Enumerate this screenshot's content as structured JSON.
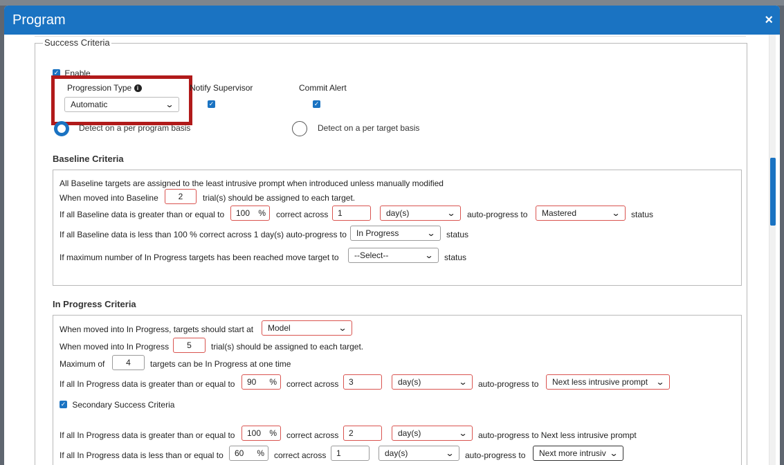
{
  "modal": {
    "title": "Program",
    "close": "×"
  },
  "success_criteria": {
    "legend": "Success Criteria",
    "enable_label": "Enable",
    "enable_checked": true,
    "progression_type_label": "Progression Type",
    "progression_type_value": "Automatic",
    "info_icon": "i",
    "notify_supervisor_label": "Notify Supervisor",
    "notify_supervisor_checked": true,
    "commit_alert_label": "Commit Alert",
    "commit_alert_checked": true,
    "radio_per_program": "Detect on a per program basis",
    "radio_per_target": "Detect on a per target basis",
    "selected_mode": "per_program"
  },
  "baseline": {
    "title": "Baseline Criteria",
    "note": "All Baseline targets are assigned to the least intrusive prompt when introduced unless manually modified",
    "moved_into_prefix": "When moved into Baseline",
    "moved_into_value": "2",
    "moved_into_suffix": "trial(s) should be assigned to each target.",
    "ge_prefix": "If all Baseline data is greater than or equal to",
    "ge_percent": "100",
    "pct_sign": "%",
    "correct_across": "correct across",
    "ge_days": "1",
    "period": "day(s)",
    "auto_progress_to": "auto-progress to",
    "ge_status": "Mastered",
    "status": "status",
    "lt_prefix": "If all Baseline data is less than 100 % correct across 1 day(s) auto-progress to",
    "lt_status": "In Progress",
    "max_prefix": "If maximum number of In Progress targets has been reached move target to",
    "max_status": "--Select--"
  },
  "in_progress": {
    "title": "In Progress Criteria",
    "start_prefix": "When moved into In Progress, targets should start at",
    "start_value": "Model",
    "moved_into_prefix": "When moved into In Progress",
    "moved_into_value": "5",
    "moved_into_suffix": "trial(s) should be assigned to each target.",
    "max_prefix": "Maximum of",
    "max_value": "4",
    "max_suffix": "targets can be In Progress at one time",
    "ge_prefix": "If all In Progress data is greater than or equal to",
    "ge_percent": "90",
    "ge_days": "3",
    "ge_status": "Next less intrusive prompt",
    "secondary_label": "Secondary Success Criteria",
    "secondary_checked": true,
    "ge2_percent": "100",
    "ge2_days": "2",
    "ge2_suffix": "auto-progress to Next less intrusive prompt",
    "le_prefix": "If all In Progress data is less than or equal to",
    "le_percent": "60",
    "le_days": "1",
    "le_status": "Next more intrusiv"
  }
}
